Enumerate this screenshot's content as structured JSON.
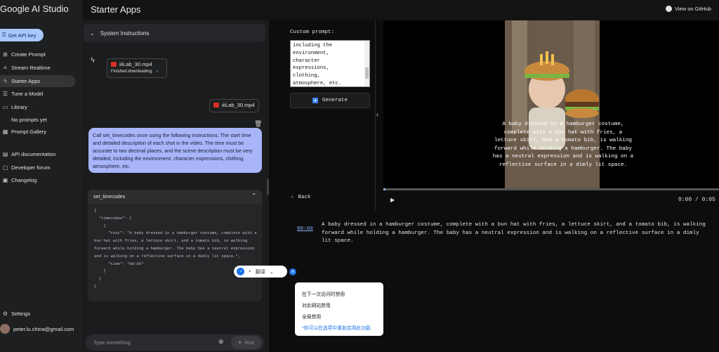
{
  "app": {
    "brand": "Google AI Studio",
    "page_title": "Starter Apps",
    "github_label": "View on GitHub"
  },
  "sidebar": {
    "api_key_label": "Get API key",
    "items": [
      {
        "label": "Create Prompt",
        "icon": "create-prompt-icon"
      },
      {
        "label": "Stream Realtime",
        "icon": "stream-icon"
      },
      {
        "label": "Starter Apps",
        "icon": "starter-apps-icon"
      },
      {
        "label": "Tune a Model",
        "icon": "tune-icon"
      },
      {
        "label": "Library",
        "icon": "library-icon"
      }
    ],
    "no_prompts": "No prompts yet",
    "prompt_gallery": "Prompt Gallery",
    "links": [
      {
        "label": "API documentation",
        "icon": "doc-icon"
      },
      {
        "label": "Developer forum",
        "icon": "forum-icon"
      },
      {
        "label": "Changelog",
        "icon": "changelog-icon"
      }
    ],
    "settings": "Settings",
    "user_email": "peter.lu.china@gmail.com"
  },
  "chat": {
    "system_instructions": "System Instructions",
    "file_name_1": "iiiLab_30.mp4",
    "file_status": "Finished downloading.",
    "file_name_2": "iiiLab_30.mp4",
    "prompt": "Call set_timecodes once using the following instructions: The start time and detailed description of each shot in the video. The time must be accurate to two decimal places, and the scene description must be very detailed, including the environment, character expressions, clothing, atmosphere, etc.",
    "function_name": "set_timecodes",
    "code_lines": [
      "{",
      "  \"timecodes\": [",
      "    {",
      "      \"text\": \"A baby dressed in a hamburger costume, complete with a",
      "bun hat with fries, a lettuce skirt, and a tomato bib, is walking",
      "forward while holding a hamburger. The baby has a neutral expression",
      "and is walking on a reflective surface in a dimly lit space.\",",
      "      \"time\": \"00:00\"",
      "    }",
      "  ]",
      "}"
    ],
    "input_placeholder": "Type something",
    "run_label": "Run"
  },
  "app_panel": {
    "custom_prompt_label": "Custom prompt:",
    "custom_prompt_lines": [
      "including the",
      "environment,",
      "character",
      "expressions,",
      "clothing,",
      "atmosphere, etc."
    ],
    "generate_label": "Generate",
    "back_label": "Back",
    "time_display": "0:00 / 0:05",
    "progress": 0.0,
    "caption": "A baby dressed in a hamburger costume, complete with a bun hat with fries, a lettuce skirt, and a tomato bib, is walking forward while holding a hamburger. The baby has a neutral expression and is walking on a reflective surface in a dimly lit space.",
    "timecode": "00:00",
    "description": "A baby dressed in a hamburger costume, complete with a bun hat with fries, a lettuce skirt, and a tomato bib, is walking forward while holding a hamburger. The baby has a neutral expression and is walking on a reflective surface in a dimly lit space."
  },
  "translate_widget": {
    "label": "翻译",
    "menu": [
      "在下一次访问时禁用",
      "对此网站禁用",
      "全局禁用"
    ],
    "note": "*你可以在选项中重新启用此功能"
  },
  "colors": {
    "accent": "#a8c7fa",
    "prompt_bubble": "#a8b5f9",
    "link": "#8ab4f8"
  }
}
